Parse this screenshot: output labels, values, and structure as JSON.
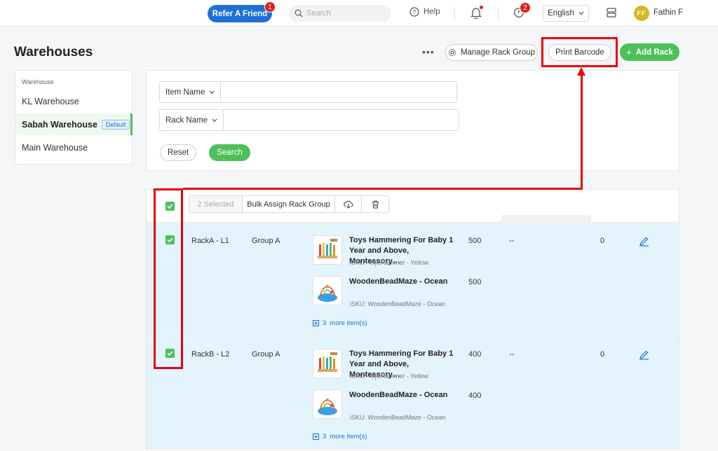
{
  "topbar": {
    "refer_label": "Refer A Friend",
    "refer_badge": "1",
    "search_placeholder": "Search",
    "help_label": "Help",
    "timer_badge": "2",
    "language": "English",
    "avatar_initials": "FF",
    "user_name": "Fathin F"
  },
  "header": {
    "title": "Warehouses",
    "more_label": "•••",
    "manage_label": "Manage Rack Group",
    "print_label": "Print Barcode",
    "add_label": "Add Rack"
  },
  "sidebar": {
    "heading": "Warehouse",
    "items": [
      {
        "label": "KL Warehouse",
        "tag": ""
      },
      {
        "label": "Sabah Warehouse",
        "tag": "Default"
      },
      {
        "label": "Main Warehouse",
        "tag": ""
      }
    ]
  },
  "filters": {
    "item_name_label": "Item Name",
    "item_name_value": "",
    "rack_name_label": "Rack Name",
    "rack_name_value": "",
    "reset_label": "Reset",
    "search_label": "Search"
  },
  "bulk": {
    "selected_label": "2 Selected",
    "assign_label": "Bulk Assign Rack Group"
  },
  "rows": [
    {
      "rack": "RackA - L1",
      "group": "Group A",
      "products": [
        {
          "name": "Toys Hammering For Baby 1 Year and Above, Montessory…",
          "sku": "iSKU: ToysHammer - Yellow",
          "qty": "500"
        },
        {
          "name": "WoodenBeadMaze - Ocean",
          "sku": "iSKU: WoodenBeadMaze - Ocean",
          "qty": "500"
        }
      ],
      "more_count": "3",
      "more_label": "more item(s)",
      "dash": "--",
      "count": "0"
    },
    {
      "rack": "RackB - L2",
      "group": "Group A",
      "products": [
        {
          "name": "Toys Hammering For Baby 1 Year and Above, Montessory…",
          "sku": "iSKU: ToysHammer - Yellow",
          "qty": "400"
        },
        {
          "name": "WoodenBeadMaze - Ocean",
          "sku": "iSKU: WoodenBeadMaze - Ocean",
          "qty": "400"
        }
      ],
      "more_count": "3",
      "more_label": "more item(s)",
      "dash": "--",
      "count": "0"
    }
  ],
  "colors": {
    "accent_green": "#4ec05a",
    "accent_blue": "#1e6fd9",
    "annotation_red": "#e8000b",
    "selected_row": "#e4f4fc"
  },
  "icons": {
    "search": "search-icon",
    "help": "help-circle-icon",
    "bell": "bell-icon",
    "timer": "timer-icon",
    "layout": "layout-icon",
    "gear": "gear-icon",
    "plus": "plus-icon",
    "download": "cloud-download-icon",
    "delete": "trash-icon",
    "edit": "pencil-icon"
  }
}
